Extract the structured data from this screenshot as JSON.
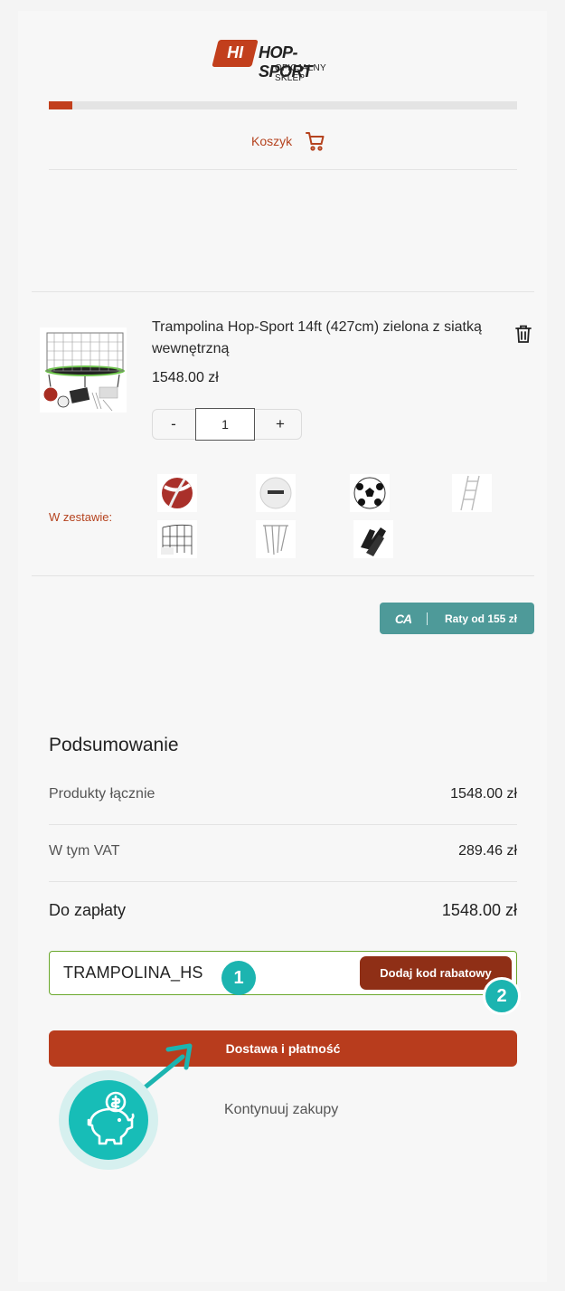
{
  "header": {
    "logo_mark": "HI",
    "logo_brand": "HOP-SPORT",
    "logo_subtitle": "OFICJALNY SKLEP",
    "progress_fraction": 0.05,
    "cart_label": "Koszyk"
  },
  "product": {
    "title": "Trampolina Hop-Sport 14ft (427cm) zielona z siatką wewnętrzną",
    "price": "1548.00 zł",
    "quantity": "1",
    "minus_label": "-",
    "plus_label": "+"
  },
  "set": {
    "label": "W zestawie:",
    "items": [
      "volleyball-icon",
      "white-ball-icon",
      "soccer-ball-icon",
      "ladder-icon",
      "net-icon",
      "stakes-icon",
      "gloves-icon"
    ]
  },
  "installments": {
    "brand_mark": "CA",
    "label": "Raty od 155 zł"
  },
  "summary": {
    "title": "Podsumowanie",
    "products_label": "Produkty łącznie",
    "products_value": "1548.00 zł",
    "vat_label": "W tym VAT",
    "vat_value": "289.46 zł",
    "total_label": "Do zapłaty",
    "total_value": "1548.00 zł"
  },
  "coupon": {
    "code": "TRAMPOLINA_HS",
    "apply_label": "Dodaj kod rabatowy"
  },
  "badges": {
    "one": "1",
    "two": "2"
  },
  "actions": {
    "checkout_label": "Dostawa i płatność",
    "continue_label": "Kontynuuj zakupy"
  },
  "colors": {
    "brand": "#c23f1c",
    "accent_teal": "#1cb4b0",
    "installments": "#4e9a99",
    "coupon_border": "#6aa82c"
  }
}
